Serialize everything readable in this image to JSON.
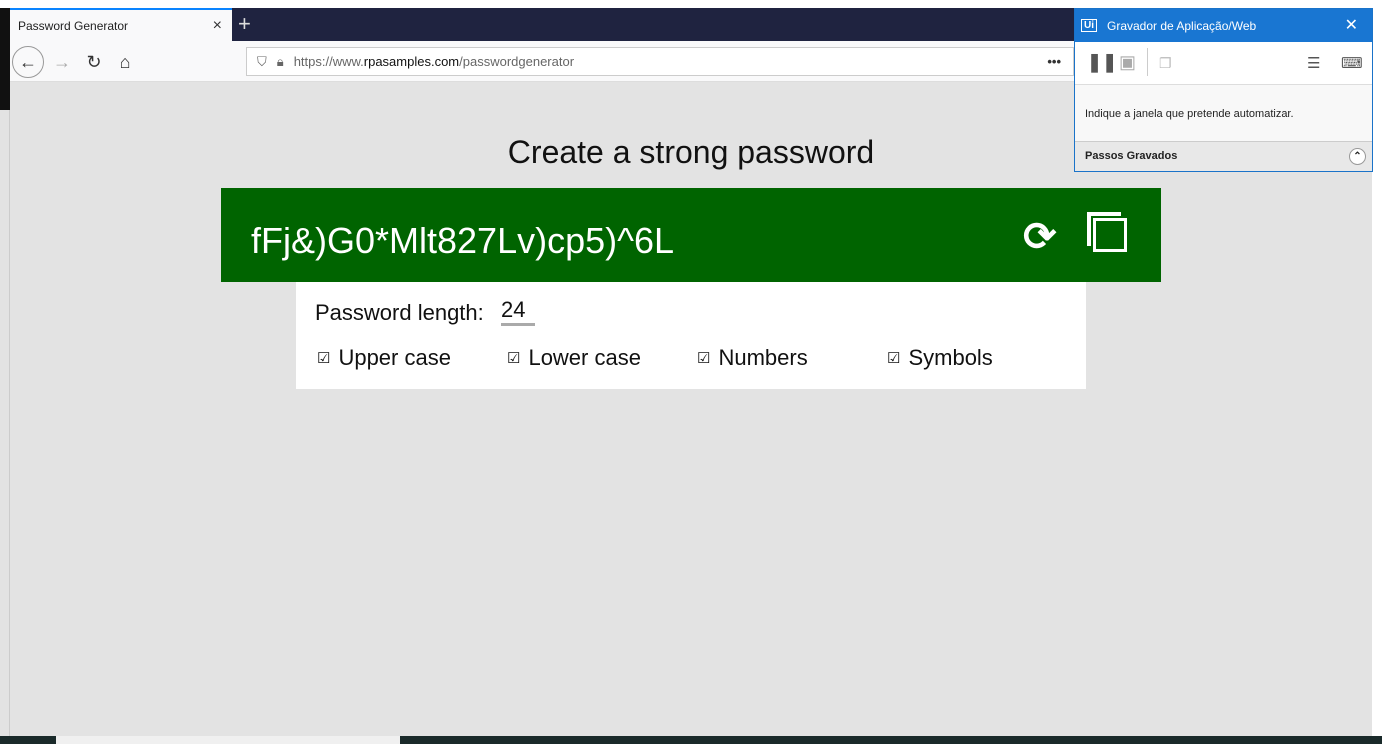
{
  "browser": {
    "tab_title": "Password Generator",
    "tab_close": "×",
    "new_tab": "+",
    "url_prefix": "https://www.",
    "url_host": "rpasamples.com",
    "url_path": "/passwordgenerator",
    "menu_dots": "•••"
  },
  "page": {
    "title": "Create a strong password",
    "password": "fFj&)G0*Mlt827Lv)cp5)^6L",
    "length_label": "Password length:",
    "length_value": "24",
    "options": [
      {
        "label": "Upper case",
        "checked": true
      },
      {
        "label": "Lower case",
        "checked": true
      },
      {
        "label": "Numbers",
        "checked": true
      },
      {
        "label": "Symbols",
        "checked": true
      }
    ],
    "accent": "#006400"
  },
  "recorder": {
    "logo": "Ui",
    "title": "Gravador de Aplicação/Web",
    "message": "Indique a janela que pretende automatizar.",
    "footer": "Passos Gravados",
    "accent": "#1976d2"
  }
}
